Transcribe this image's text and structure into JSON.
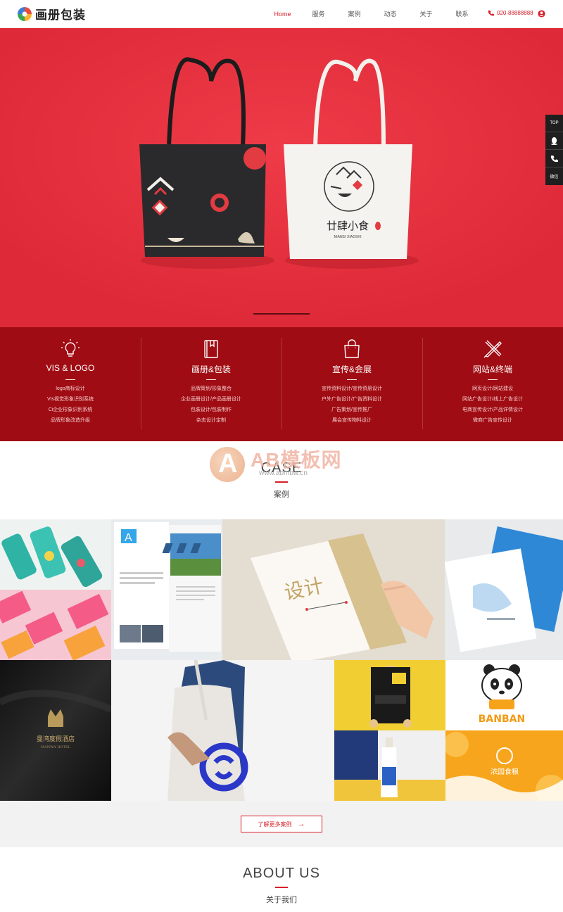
{
  "header": {
    "brand": "画册包装",
    "nav": [
      "Home",
      "服务",
      "案例",
      "动态",
      "关于",
      "联系"
    ],
    "phone": "020-88888888"
  },
  "side_tools": [
    "TOP",
    "QQ",
    "电话",
    "微信"
  ],
  "banner": {
    "bag_dark_text": "个",
    "bag_light_brand": "廿肆小食",
    "bag_light_sub": "NIANSI XIAOSHI"
  },
  "services": [
    {
      "icon": "lightbulb-icon",
      "title": "VIS & LOGO",
      "items": [
        "logo商标设计",
        "VIs视觉形象识别系统",
        "Ci企业形象识别系统",
        "品牌形象改造升级"
      ]
    },
    {
      "icon": "book-icon",
      "title": "画册&包装",
      "items": [
        "品牌策划/形象整合",
        "企业画册设计/产品画册设计",
        "包装设计/包装制作",
        "杂志设计定制"
      ]
    },
    {
      "icon": "shopping-bag-icon",
      "title": "宣传&会展",
      "items": [
        "宣传资料设计/宣传资册设计",
        "户外广告设计/广告资料设计",
        "广告策划/宣传推广",
        "展会宣传物料设计"
      ]
    },
    {
      "icon": "pen-ruler-icon",
      "title": "网站&终端",
      "items": [
        "网页设计/网站建设",
        "网站广告设计/线上广告设计",
        "电商宣传设计/产品详情设计",
        "微商广告宣传设计"
      ]
    }
  ],
  "case_section": {
    "title_en": "CASE",
    "title_cn": "案例"
  },
  "watermark": {
    "text": "AB模板网",
    "url": "www.abmbw.cn"
  },
  "grid_text": {
    "hotel_cn": "曼湾度假酒店",
    "hotel_en": "MANWA HOTEL",
    "banban": "BANBAN",
    "juice": "浓园食粮",
    "book_cover": "设计",
    "brochure_logo": "A"
  },
  "more_button": "了解更多案例",
  "about_section": {
    "title_en": "ABOUT US",
    "title_cn": "关于我们"
  }
}
